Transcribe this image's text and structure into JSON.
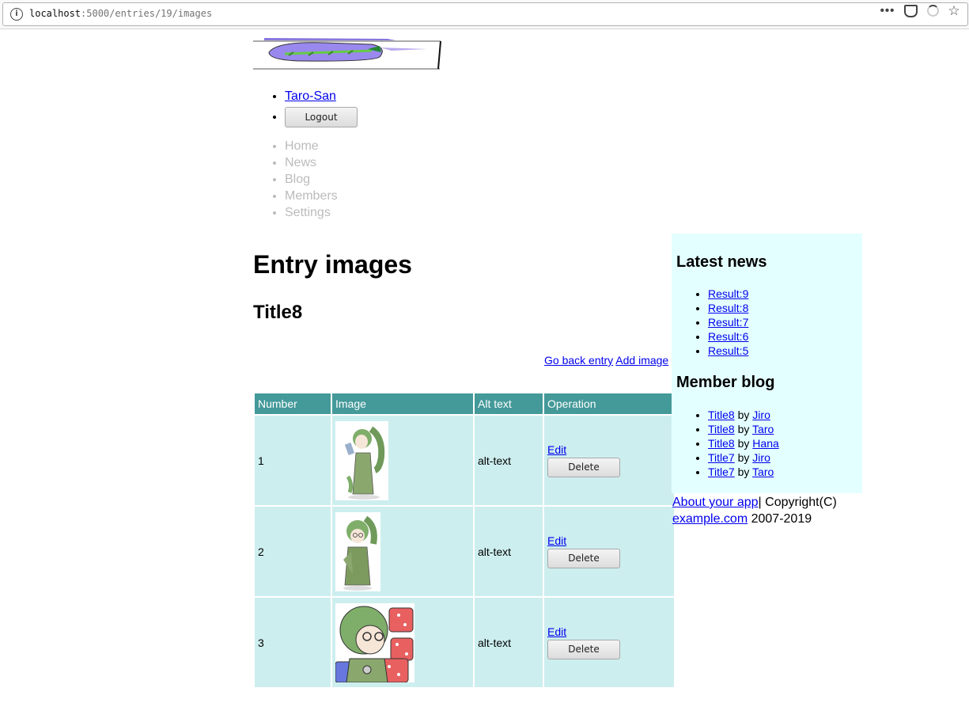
{
  "browser": {
    "url_host": "localhost",
    "url_path": ":5000/entries/19/images"
  },
  "header": {
    "user_link": "Taro-San",
    "logout_label": "Logout"
  },
  "nav": {
    "items": [
      {
        "label": "Home"
      },
      {
        "label": "News"
      },
      {
        "label": "Blog"
      },
      {
        "label": "Members"
      },
      {
        "label": "Settings"
      }
    ]
  },
  "main": {
    "page_title": "Entry images",
    "entry_title": "Title8",
    "go_back_link": "Go back entry",
    "add_image_link": "Add image",
    "table": {
      "headers": [
        "Number",
        "Image",
        "Alt text",
        "Operation"
      ],
      "rows": [
        {
          "number": "1",
          "alt": "alt-text",
          "edit_label": "Edit",
          "delete_label": "Delete"
        },
        {
          "number": "2",
          "alt": "alt-text",
          "edit_label": "Edit",
          "delete_label": "Delete"
        },
        {
          "number": "3",
          "alt": "alt-text",
          "edit_label": "Edit",
          "delete_label": "Delete"
        }
      ]
    }
  },
  "sidebar": {
    "news_heading": "Latest news",
    "news": [
      "Result:9",
      "Result:8",
      "Result:7",
      "Result:6",
      "Result:5"
    ],
    "blog_heading": "Member blog",
    "by_word": "by",
    "blog": [
      {
        "title": "Title8",
        "author": "Jiro"
      },
      {
        "title": "Title8",
        "author": "Taro"
      },
      {
        "title": "Title8",
        "author": "Hana"
      },
      {
        "title": "Title7",
        "author": "Jiro"
      },
      {
        "title": "Title7",
        "author": "Taro"
      }
    ]
  },
  "footer": {
    "about_link": "About your app",
    "copyright_text": "| Copyright(C)",
    "domain_link": "example.com",
    "years": "2007-2019"
  }
}
